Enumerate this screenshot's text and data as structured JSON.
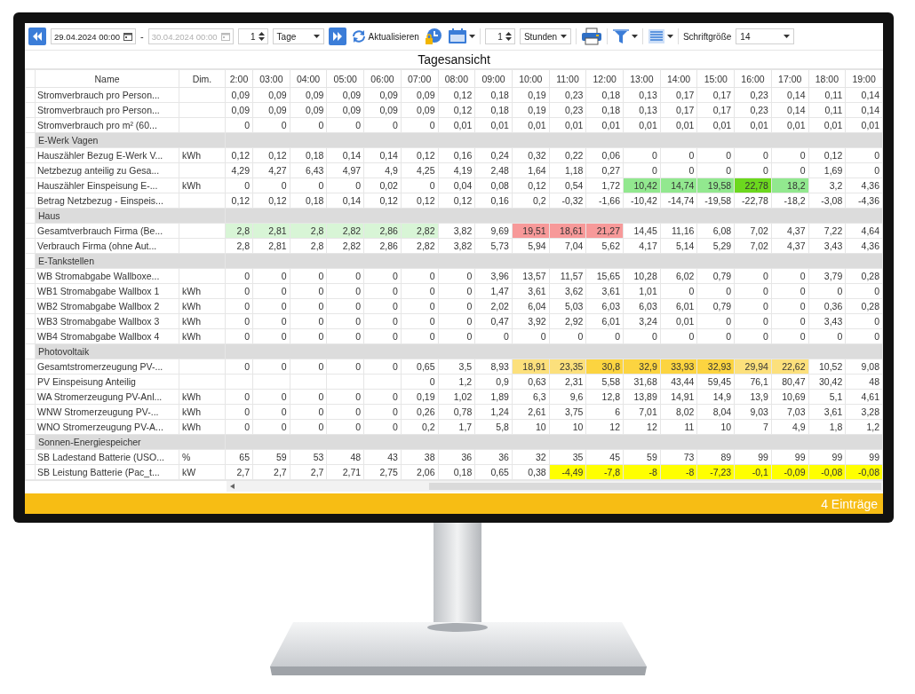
{
  "toolbar": {
    "start_date": {
      "value": "29.04.2024 00:00",
      "disabled": false
    },
    "range_separator": "-",
    "end_date": {
      "value": "30.04.2024 00:00",
      "disabled": true
    },
    "period_count": "1",
    "period_unit": "Tage",
    "refresh_label": "Aktualisieren",
    "interval_count": "1",
    "interval_unit": "Stunden",
    "font_size_label": "Schriftgröße",
    "font_size": "14"
  },
  "title": "Tagesansicht",
  "table": {
    "columns": [
      "Name",
      "Dim.",
      "2:00",
      "03:00",
      "04:00",
      "05:00",
      "06:00",
      "07:00",
      "08:00",
      "09:00",
      "10:00",
      "11:00",
      "12:00",
      "13:00",
      "14:00",
      "15:00",
      "16:00",
      "17:00",
      "18:00",
      "19:00"
    ],
    "rows": [
      {
        "kind": "data",
        "name": "Stromverbrauch pro Person...",
        "cells": [
          "0,09",
          "0,09",
          "0,09",
          "0,09",
          "0,09",
          "0,09",
          "0,12",
          "0,18",
          "0,19",
          "0,23",
          "0,18",
          "0,13",
          "0,17",
          "0,17",
          "0,23",
          "0,14",
          "0,11",
          "0,14"
        ]
      },
      {
        "kind": "data",
        "name": "Stromverbrauch pro Person...",
        "cells": [
          "0,09",
          "0,09",
          "0,09",
          "0,09",
          "0,09",
          "0,09",
          "0,12",
          "0,18",
          "0,19",
          "0,23",
          "0,18",
          "0,13",
          "0,17",
          "0,17",
          "0,23",
          "0,14",
          "0,11",
          "0,14"
        ]
      },
      {
        "kind": "data",
        "name": "Stromverbrauch pro m² (60...",
        "cells": [
          "0",
          "0",
          "0",
          "0",
          "0",
          "0",
          "0,01",
          "0,01",
          "0,01",
          "0,01",
          "0,01",
          "0,01",
          "0,01",
          "0,01",
          "0,01",
          "0,01",
          "0,01",
          "0,01"
        ]
      },
      {
        "kind": "group",
        "name": "E-Werk Vagen"
      },
      {
        "kind": "data",
        "name": "Hauszähler Bezug E-Werk V...",
        "unit": "kWh",
        "cells": [
          "0,12",
          "0,12",
          "0,18",
          "0,14",
          "0,14",
          "0,12",
          "0,16",
          "0,24",
          "0,32",
          "0,22",
          "0,06",
          "0",
          "0",
          "0",
          "0",
          "0",
          "0,12",
          "0"
        ]
      },
      {
        "kind": "data",
        "name": "Netzbezug anteilig zu Gesa...",
        "cells": [
          "4,29",
          "4,27",
          "6,43",
          "4,97",
          "4,9",
          "4,25",
          "4,19",
          "2,48",
          "1,64",
          "1,18",
          "0,27",
          "0",
          "0",
          "0",
          "0",
          "0",
          "1,69",
          "0"
        ]
      },
      {
        "kind": "data",
        "name": "Hauszähler Einspeisung E-...",
        "unit": "kWh",
        "cells": [
          "0",
          "0",
          "0",
          "0",
          "0,02",
          "0",
          "0,04",
          "0,08",
          "0,12",
          "0,54",
          "1,72",
          {
            "text": "10,42",
            "color": "#92e88f"
          },
          {
            "text": "14,74",
            "color": "#92e88f"
          },
          {
            "text": "19,58",
            "color": "#92e88f"
          },
          {
            "text": "22,78",
            "color": "#6cd81e"
          },
          {
            "text": "18,2",
            "color": "#92e88f"
          },
          "3,2",
          "4,36"
        ]
      },
      {
        "kind": "data",
        "name": "Betrag Netzbezug - Einspeis...",
        "cells": [
          "0,12",
          "0,12",
          "0,18",
          "0,14",
          "0,12",
          "0,12",
          "0,12",
          "0,16",
          "0,2",
          "-0,32",
          "-1,66",
          "-10,42",
          "-14,74",
          "-19,58",
          "-22,78",
          "-18,2",
          "-3,08",
          "-4,36"
        ]
      },
      {
        "kind": "group",
        "name": "Haus"
      },
      {
        "kind": "data",
        "name": "Gesamtverbrauch Firma (Be...",
        "cells": [
          {
            "text": "2,8",
            "color": "#d8f5d6"
          },
          {
            "text": "2,81",
            "color": "#d8f5d6"
          },
          {
            "text": "2,8",
            "color": "#d8f5d6"
          },
          {
            "text": "2,82",
            "color": "#d8f5d6"
          },
          {
            "text": "2,86",
            "color": "#d8f5d6"
          },
          {
            "text": "2,82",
            "color": "#d8f5d6"
          },
          "3,82",
          "9,69",
          {
            "text": "19,51",
            "color": "#f79999"
          },
          {
            "text": "18,61",
            "color": "#f79999"
          },
          {
            "text": "21,27",
            "color": "#f79999"
          },
          "14,45",
          "11,16",
          "6,08",
          "7,02",
          "4,37",
          "7,22",
          "4,64"
        ]
      },
      {
        "kind": "data",
        "name": "Verbrauch Firma (ohne Aut...",
        "cells": [
          "2,8",
          "2,81",
          "2,8",
          "2,82",
          "2,86",
          "2,82",
          "3,82",
          "5,73",
          "5,94",
          "7,04",
          "5,62",
          "4,17",
          "5,14",
          "5,29",
          "7,02",
          "4,37",
          "3,43",
          "4,36"
        ]
      },
      {
        "kind": "group",
        "name": "E-Tankstellen"
      },
      {
        "kind": "data",
        "name": "WB Stromabgabe Wallboxe...",
        "cells": [
          "0",
          "0",
          "0",
          "0",
          "0",
          "0",
          "0",
          "3,96",
          "13,57",
          "11,57",
          "15,65",
          "10,28",
          "6,02",
          "0,79",
          "0",
          "0",
          "3,79",
          "0,28"
        ]
      },
      {
        "kind": "data",
        "name": "WB1 Stromabgabe Wallbox 1",
        "unit": "kWh",
        "cells": [
          "0",
          "0",
          "0",
          "0",
          "0",
          "0",
          "0",
          "1,47",
          "3,61",
          "3,62",
          "3,61",
          "1,01",
          "0",
          "0",
          "0",
          "0",
          "0",
          "0"
        ]
      },
      {
        "kind": "data",
        "name": "WB2 Stromabgabe Wallbox 2",
        "unit": "kWh",
        "cells": [
          "0",
          "0",
          "0",
          "0",
          "0",
          "0",
          "0",
          "2,02",
          "6,04",
          "5,03",
          "6,03",
          "6,03",
          "6,01",
          "0,79",
          "0",
          "0",
          "0,36",
          "0,28"
        ]
      },
      {
        "kind": "data",
        "name": "WB3 Stromabgabe Wallbox 3",
        "unit": "kWh",
        "cells": [
          "0",
          "0",
          "0",
          "0",
          "0",
          "0",
          "0",
          "0,47",
          "3,92",
          "2,92",
          "6,01",
          "3,24",
          "0,01",
          "0",
          "0",
          "0",
          "3,43",
          "0"
        ]
      },
      {
        "kind": "data",
        "name": "WB4 Stromabgabe Wallbox 4",
        "unit": "kWh",
        "cells": [
          "0",
          "0",
          "0",
          "0",
          "0",
          "0",
          "0",
          "0",
          "0",
          "0",
          "0",
          "0",
          "0",
          "0",
          "0",
          "0",
          "0",
          "0"
        ]
      },
      {
        "kind": "group",
        "name": "Photovoltaik"
      },
      {
        "kind": "data",
        "name": "Gesamtstromerzeugung PV-...",
        "cells": [
          "0",
          "0",
          "0",
          "0",
          "0",
          "0,65",
          "3,5",
          "8,93",
          {
            "text": "18,91",
            "color": "#fce07c"
          },
          {
            "text": "23,35",
            "color": "#fce07c"
          },
          {
            "text": "30,8",
            "color": "#fcd440"
          },
          {
            "text": "32,9",
            "color": "#fcd440"
          },
          {
            "text": "33,93",
            "color": "#fcd440"
          },
          {
            "text": "32,93",
            "color": "#fcd440"
          },
          {
            "text": "29,94",
            "color": "#fce07c"
          },
          {
            "text": "22,62",
            "color": "#fce07c"
          },
          "10,52",
          "9,08"
        ]
      },
      {
        "kind": "data",
        "name": "PV Einspeisung Anteilig",
        "cells": [
          null,
          null,
          null,
          null,
          null,
          "0",
          "1,2",
          "0,9",
          "0,63",
          "2,31",
          "5,58",
          "31,68",
          "43,44",
          "59,45",
          "76,1",
          "80,47",
          "30,42",
          "48"
        ]
      },
      {
        "kind": "data",
        "name": "WA Stromerzeugung PV-Anl...",
        "unit": "kWh",
        "cells": [
          "0",
          "0",
          "0",
          "0",
          "0",
          "0,19",
          "1,02",
          "1,89",
          "6,3",
          "9,6",
          "12,8",
          "13,89",
          "14,91",
          "14,9",
          "13,9",
          "10,69",
          "5,1",
          "4,61"
        ]
      },
      {
        "kind": "data",
        "name": "WNW Stromerzeugung PV-...",
        "unit": "kWh",
        "cells": [
          "0",
          "0",
          "0",
          "0",
          "0",
          "0,26",
          "0,78",
          "1,24",
          "2,61",
          "3,75",
          "6",
          "7,01",
          "8,02",
          "8,04",
          "9,03",
          "7,03",
          "3,61",
          "3,28"
        ]
      },
      {
        "kind": "data",
        "name": "WNO Stromerzeugung PV-A...",
        "unit": "kWh",
        "cells": [
          "0",
          "0",
          "0",
          "0",
          "0",
          "0,2",
          "1,7",
          "5,8",
          "10",
          "10",
          "12",
          "12",
          "11",
          "10",
          "7",
          "4,9",
          "1,8",
          "1,2"
        ]
      },
      {
        "kind": "group",
        "name": "Sonnen-Energiespeicher"
      },
      {
        "kind": "data",
        "name": "SB Ladestand Batterie (USO...",
        "unit": "%",
        "cells": [
          "65",
          "59",
          "53",
          "48",
          "43",
          "38",
          "36",
          "36",
          "32",
          "35",
          "45",
          "59",
          "73",
          "89",
          "99",
          "99",
          "99",
          "99"
        ]
      },
      {
        "kind": "data",
        "name": "SB Leistung Batterie (Pac_t...",
        "unit": "kW",
        "cells": [
          "2,7",
          "2,7",
          "2,7",
          "2,71",
          "2,75",
          "2,06",
          "0,18",
          "0,65",
          "0,38",
          {
            "text": "-4,49",
            "color": "#ffff00"
          },
          {
            "text": "-7,8",
            "color": "#ffff00"
          },
          {
            "text": "-8",
            "color": "#ffff00"
          },
          {
            "text": "-8",
            "color": "#ffff00"
          },
          {
            "text": "-7,23",
            "color": "#ffff00"
          },
          {
            "text": "-0,1",
            "color": "#ffff00"
          },
          {
            "text": "-0,09",
            "color": "#ffff00"
          },
          {
            "text": "-0,08",
            "color": "#ffff00"
          },
          {
            "text": "-0,08",
            "color": "#ffff00"
          }
        ]
      }
    ]
  },
  "status_bar": {
    "count": "4 Einträge"
  }
}
